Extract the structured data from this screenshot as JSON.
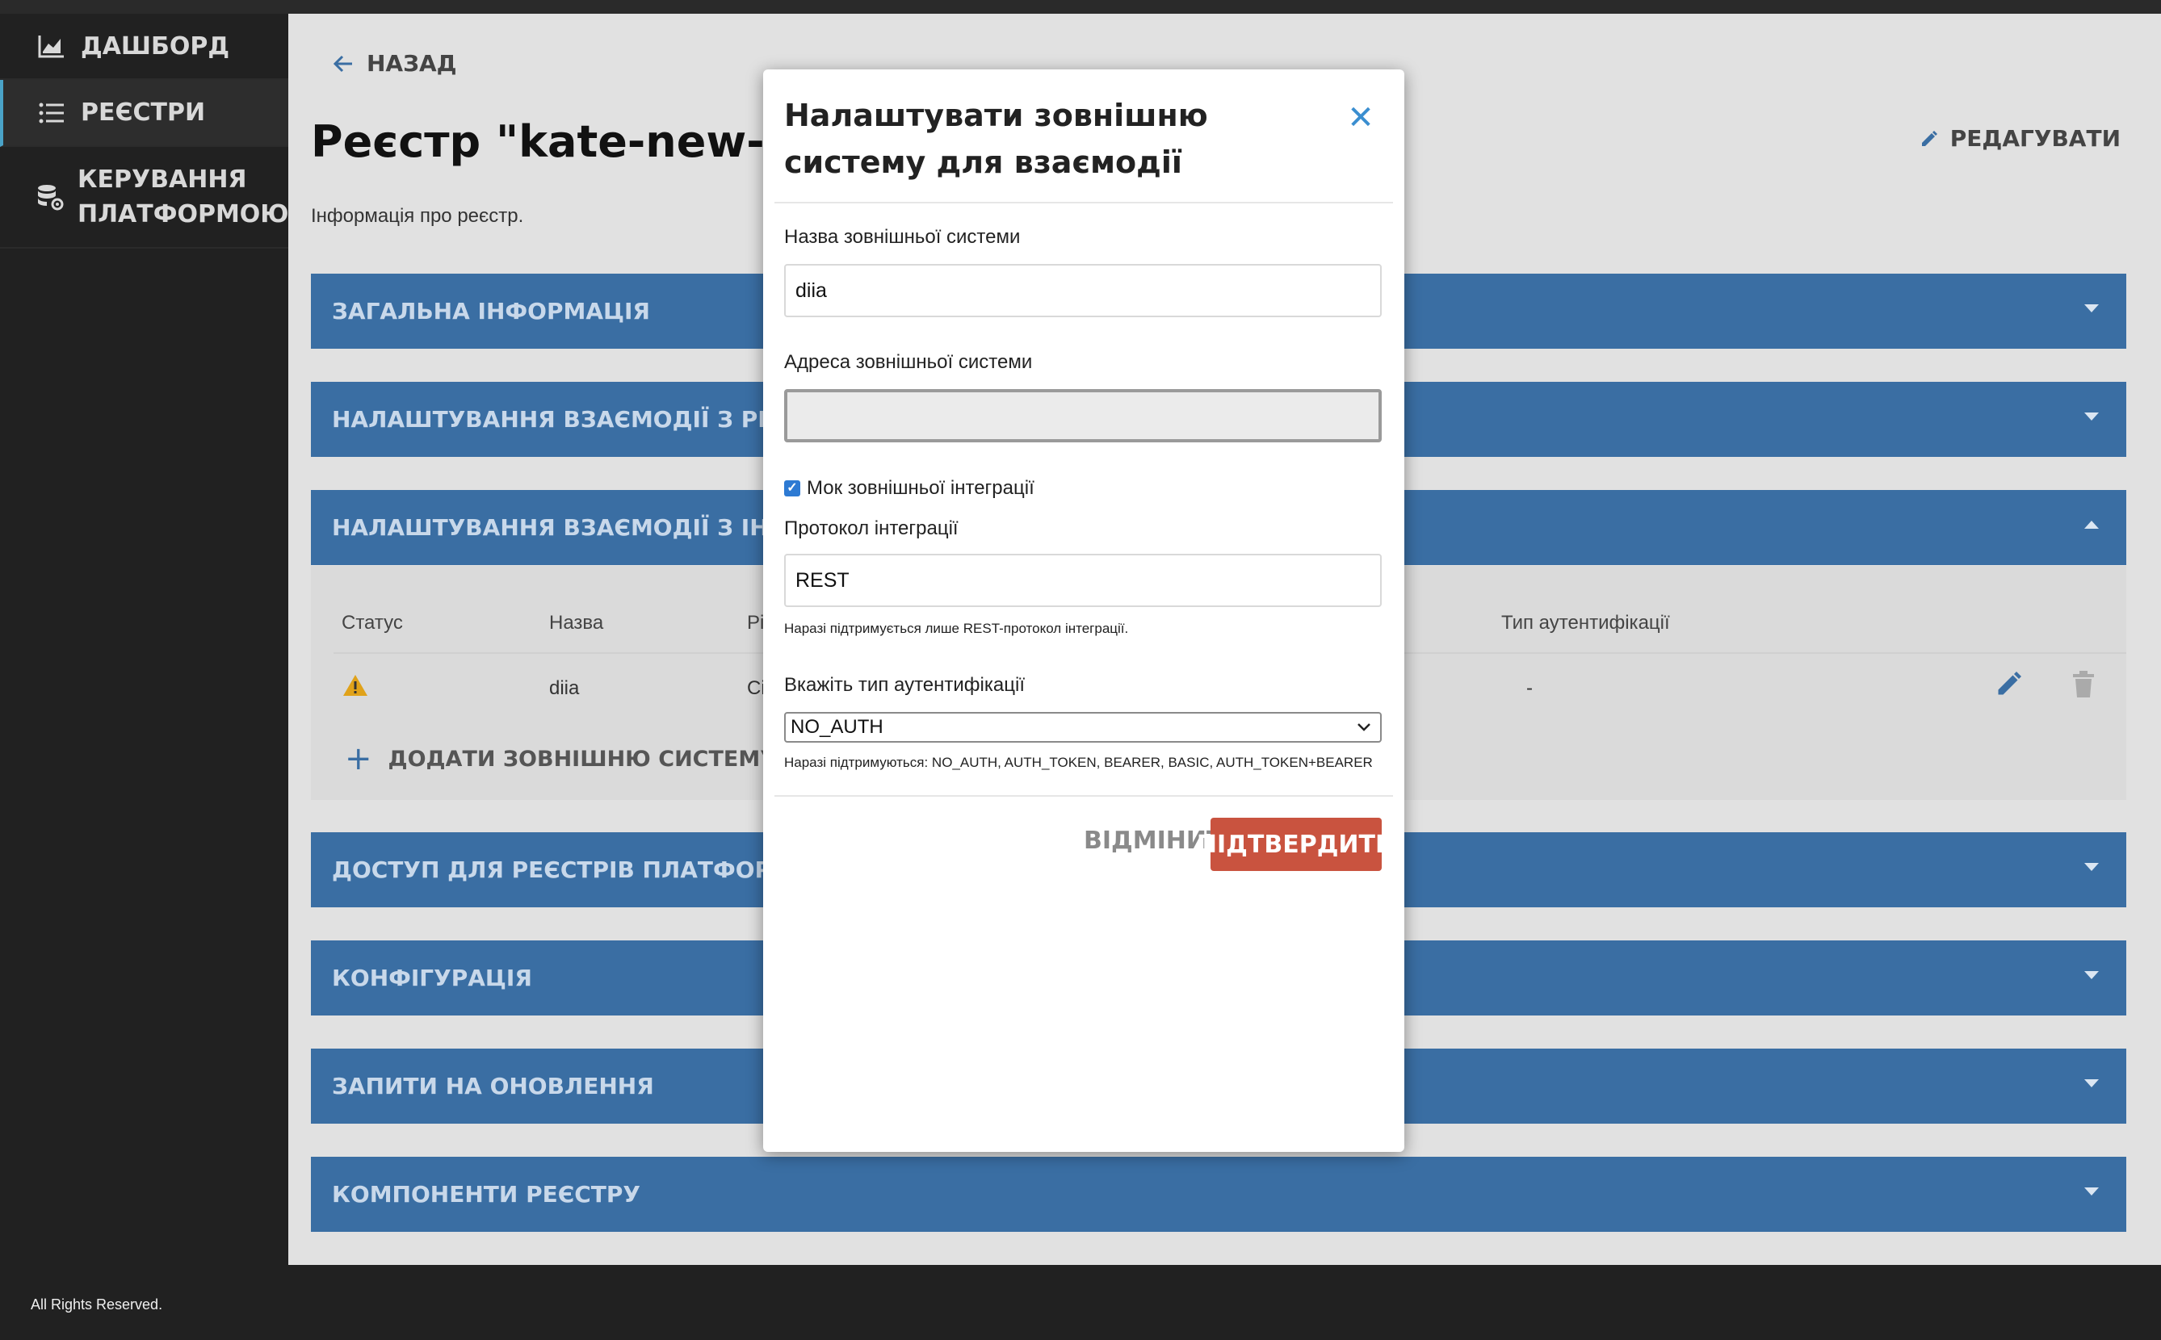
{
  "sidebar": {
    "items": [
      {
        "label": "Дашборд",
        "icon": "chart-icon"
      },
      {
        "label": "Реєстри",
        "icon": "list-icon"
      },
      {
        "label": "Керування платформою",
        "label_line1": "Керування",
        "label_line2": "платформою",
        "icon": "database-gear-icon"
      }
    ],
    "footer": "All Rights Reserved."
  },
  "main": {
    "back_label": "Назад",
    "title": "Реєстр \"kate-new-01\"",
    "subtitle": "Інформація про реєстр.",
    "edit_label": "Редагувати",
    "accordions": [
      {
        "label": "Загальна інформація"
      },
      {
        "label": "Налаштування взаємодії з реєстрами че"
      },
      {
        "label": "Налаштування взаємодії з іншими сист"
      },
      {
        "label": "Доступ для реєстрів платформи та зовн"
      },
      {
        "label": "Конфігурація"
      },
      {
        "label": "Запити на оновлення"
      },
      {
        "label": "Компоненти реєстру"
      }
    ],
    "table": {
      "headers": [
        "Статус",
        "Назва",
        "Рі",
        "Тип аутентифікації"
      ],
      "row": {
        "name": "diia",
        "col3": "Сі",
        "auth": "-"
      }
    },
    "add_external_label": "Додати зовнішню систему"
  },
  "modal": {
    "title": "Налаштувати зовнішню систему для взаємодії",
    "name_label": "Назва зовнішньої системи",
    "name_value": "diia",
    "address_label": "Адреса зовнішньої системи",
    "address_value": "",
    "mock_label": "Мок зовнішньої інтеграції",
    "mock_checked": true,
    "protocol_label": "Протокол інтеграції",
    "protocol_value": "REST",
    "protocol_hint": "Наразі підтримується лише REST-протокол інтеграції.",
    "auth_label": "Вкажіть тип аутентифікації",
    "auth_value": "NO_AUTH",
    "auth_hint": "Наразі підтримуються: NO_AUTH, AUTH_TOKEN, BEARER, BASIC, AUTH_TOKEN+BEARER",
    "cancel_label": "Відмінити",
    "confirm_label": "Підтвердити"
  },
  "colors": {
    "accent": "#3a6ea3",
    "confirm": "#c9533f",
    "link": "#3a8ed0",
    "warning": "#e0a21a"
  }
}
